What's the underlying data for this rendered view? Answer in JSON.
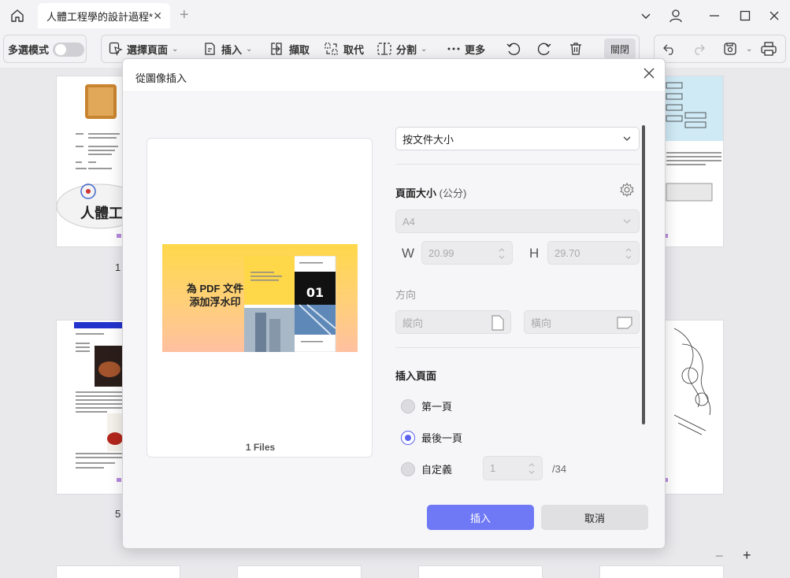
{
  "titlebar": {
    "tab_title": "人體工程學的設計過程*",
    "tab_close": "✕",
    "new_tab": "+"
  },
  "toolbar": {
    "multi_select_label": "多選模式",
    "select_page": "選擇頁面",
    "insert": "插入",
    "extract": "擷取",
    "replace": "取代",
    "split": "分割",
    "more": "更多",
    "close": "關閉"
  },
  "pages": {
    "numbers": [
      "1",
      "5"
    ],
    "thumb1_banner": "人體工程學"
  },
  "dialog": {
    "title": "從圖像插入",
    "preview_watermark_text": "為 PDF 文件\n添加浮水印",
    "preview_badge": "01",
    "files_count": "1 Files",
    "size_select_value": "按文件大小",
    "page_size_title": "頁面大小",
    "page_size_unit": "(公分)",
    "paper_value": "A4",
    "width_label": "W",
    "width_value": "20.99",
    "height_label": "H",
    "height_value": "29.70",
    "orientation_title": "方向",
    "portrait": "縱向",
    "landscape": "橫向",
    "insert_page_title": "插入頁面",
    "options": [
      {
        "label": "第一頁",
        "selected": false
      },
      {
        "label": "最後一頁",
        "selected": true
      },
      {
        "label": "自定義",
        "selected": false
      }
    ],
    "custom_page_value": "1",
    "custom_page_total": "/34",
    "insert_button": "插入",
    "cancel_button": "取消"
  },
  "zoom": {
    "minus": "−",
    "plus": "+"
  },
  "colors": {
    "accent": "#6f78f5",
    "radio_selected": "#5b63f0"
  }
}
